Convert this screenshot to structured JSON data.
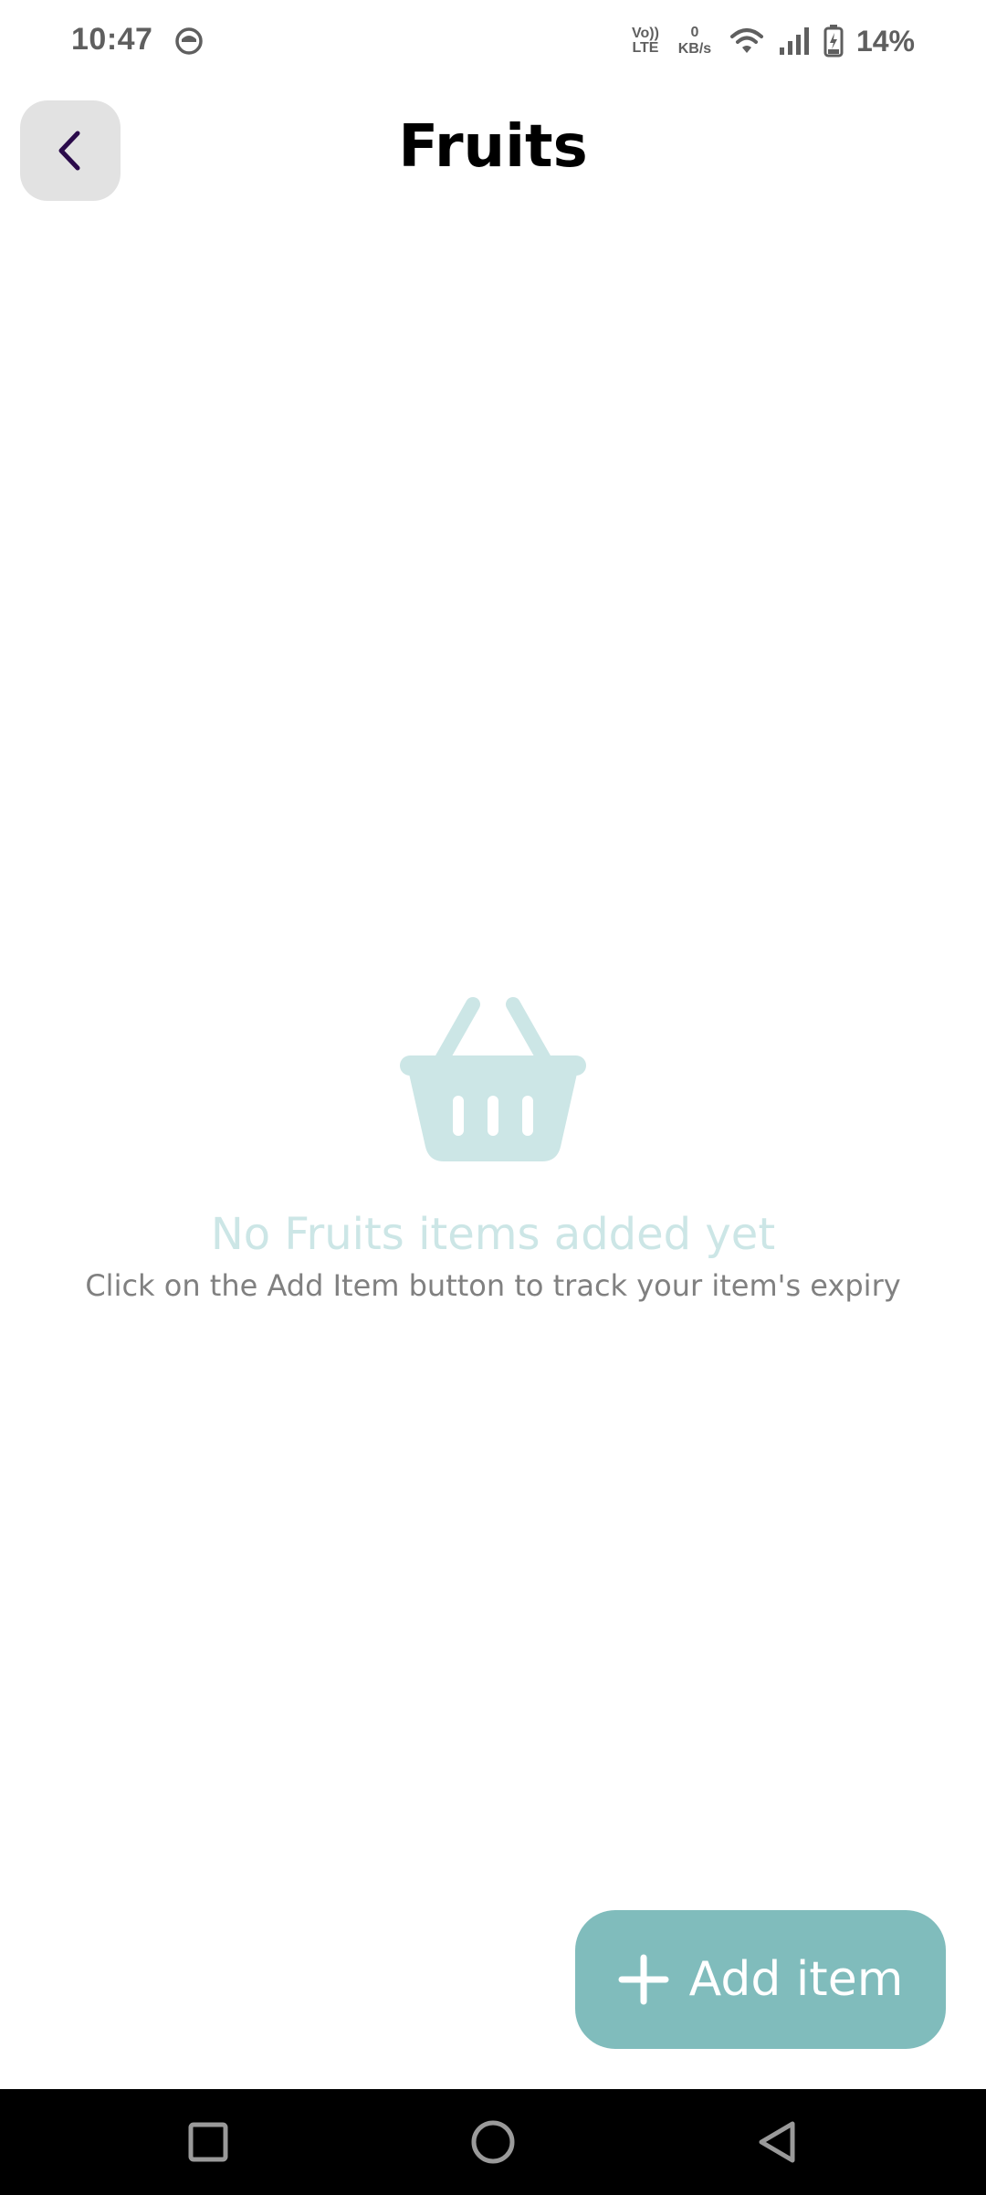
{
  "status_bar": {
    "time": "10:47",
    "volte_line1": "Vo))",
    "volte_line2": "LTE",
    "netspeed_value": "0",
    "netspeed_unit": "KB/s",
    "battery_percent": "14%",
    "icons": [
      "app-notification-icon",
      "wifi-icon",
      "signal-icon",
      "battery-charging-icon"
    ]
  },
  "header": {
    "back_icon": "chevron-left-icon",
    "title": "Fruits"
  },
  "empty_state": {
    "icon": "basket-icon",
    "title": "No Fruits items added yet",
    "subtitle": "Click on the Add Item button to track your item's expiry"
  },
  "fab": {
    "icon": "plus-icon",
    "label": "Add item"
  },
  "nav_bar": {
    "buttons": [
      "recents-button",
      "home-button",
      "back-button"
    ]
  },
  "colors": {
    "accent": "#80bcbc",
    "empty_icon": "#cce6e6",
    "back_button_bg": "#e2e2e2",
    "back_chevron": "#2a0a4a"
  }
}
